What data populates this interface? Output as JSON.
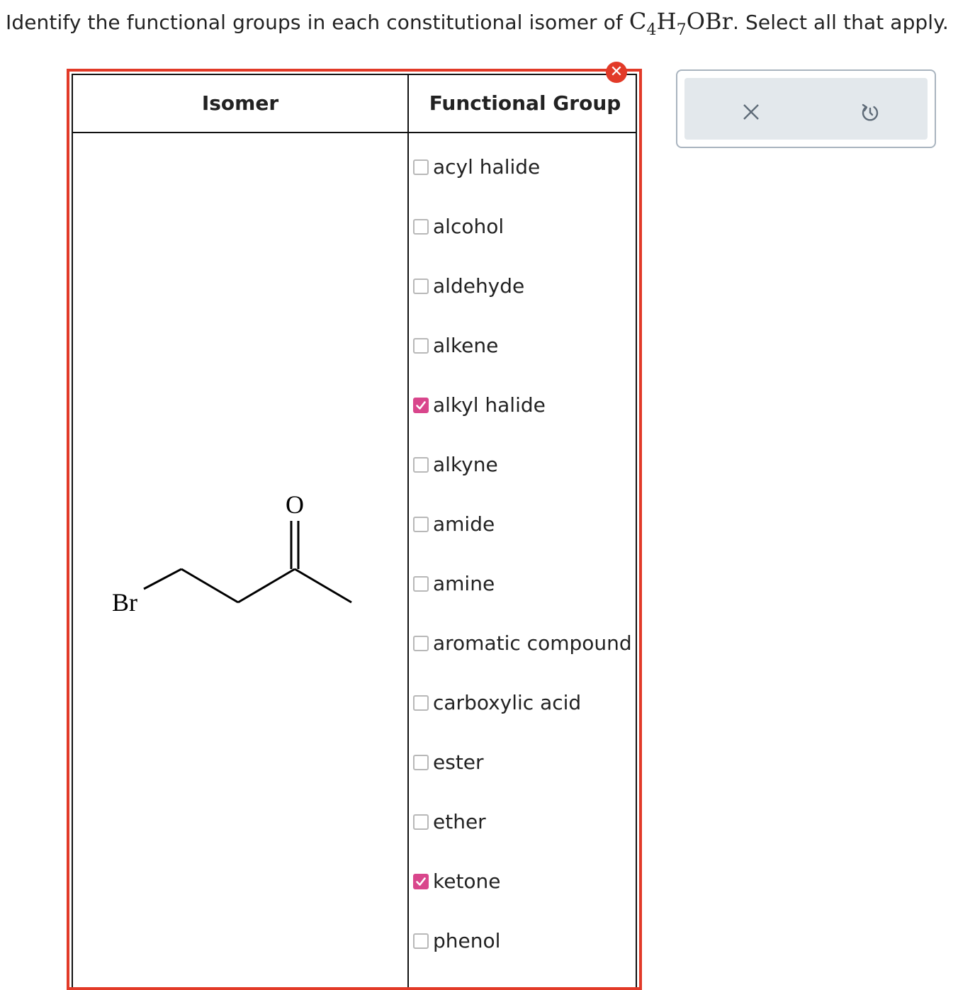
{
  "question": {
    "text_before": "Identify the functional groups in each constitutional isomer of",
    "formula": {
      "c": "C",
      "c_count": "4",
      "h": "H",
      "h_count": "7",
      "rest": "OBr"
    },
    "text_after": ". Select all that apply."
  },
  "table": {
    "header_isomer": "Isomer",
    "header_functional_group": "Functional Group",
    "status": "incorrect",
    "status_color": "#e23a28"
  },
  "molecule": {
    "atom_br": "Br",
    "atom_o": "O"
  },
  "functional_groups": [
    {
      "label": "acyl halide",
      "checked": false
    },
    {
      "label": "alcohol",
      "checked": false
    },
    {
      "label": "aldehyde",
      "checked": false
    },
    {
      "label": "alkene",
      "checked": false
    },
    {
      "label": "alkyl halide",
      "checked": true
    },
    {
      "label": "alkyne",
      "checked": false
    },
    {
      "label": "amide",
      "checked": false
    },
    {
      "label": "amine",
      "checked": false
    },
    {
      "label": "aromatic compound",
      "checked": false
    },
    {
      "label": "carboxylic acid",
      "checked": false
    },
    {
      "label": "ester",
      "checked": false
    },
    {
      "label": "ether",
      "checked": false
    },
    {
      "label": "ketone",
      "checked": true
    },
    {
      "label": "phenol",
      "checked": false
    }
  ],
  "toolbar": {
    "clear_icon": "close-icon",
    "undo_icon": "undo-icon"
  },
  "colors": {
    "checked": "#d9468c",
    "error": "#e23a28",
    "toolbar_bg": "#e3e8ec"
  }
}
